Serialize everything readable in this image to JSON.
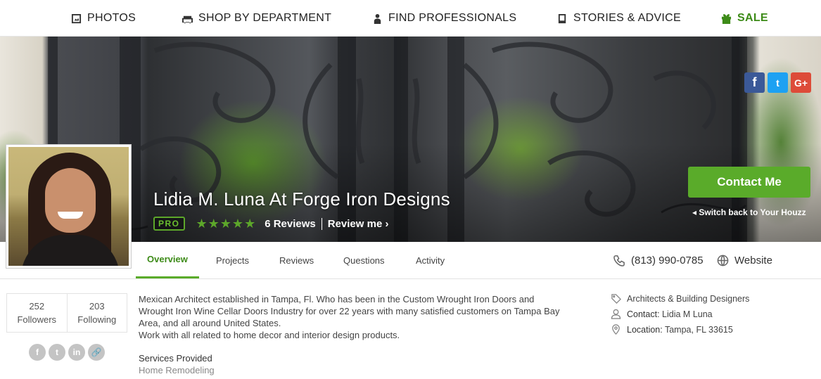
{
  "nav": {
    "items": [
      {
        "label": "PHOTOS",
        "icon": "photo-icon"
      },
      {
        "label": "SHOP BY DEPARTMENT",
        "icon": "couch-icon"
      },
      {
        "label": "FIND PROFESSIONALS",
        "icon": "person-icon"
      },
      {
        "label": "STORIES & ADVICE",
        "icon": "book-icon"
      },
      {
        "label": "SALE",
        "icon": "gift-icon",
        "color": "#3d8b18"
      }
    ]
  },
  "share_top": {
    "facebook": "f",
    "twitter": "t",
    "google": "G+"
  },
  "profile": {
    "name": "Lidia M. Luna At Forge Iron Designs",
    "badge": "PRO",
    "rating": 5,
    "stars": "★★★★★",
    "reviews": "6 Reviews",
    "review_me": "Review me ›",
    "contact_button": "Contact Me",
    "switch_back": "◂ Switch back to Your Houzz"
  },
  "tabs": [
    {
      "label": "Overview",
      "active": true
    },
    {
      "label": "Projects"
    },
    {
      "label": "Reviews"
    },
    {
      "label": "Questions"
    },
    {
      "label": "Activity"
    }
  ],
  "contact": {
    "phone": "(813) 990-0785",
    "website": "Website"
  },
  "stats": {
    "followers_count": "252",
    "followers_label": "Followers",
    "following_count": "203",
    "following_label": "Following"
  },
  "share_bottom": [
    "f",
    "t",
    "in",
    "🔗"
  ],
  "about": {
    "line1": "Mexican Architect established in Tampa, Fl. Who has been in the Custom Wrought Iron Doors and",
    "line2": "Wrought Iron Wine Cellar Doors Industry for over 22 years with many satisfied customers on Tampa Bay",
    "line3": "Area, and all around United States.",
    "line4": "Work with all related to home decor and interior design products.",
    "services_title": "Services Provided",
    "services_value": "Home Remodeling"
  },
  "details": {
    "category": "Architects & Building Designers",
    "contact_label": "Contact:",
    "contact_value": "Lidia M Luna",
    "location_label": "Location:",
    "location_value": "Tampa, FL 33615"
  },
  "colors": {
    "accent": "#5aab2a",
    "sale": "#3d8b18",
    "facebook": "#3b5998",
    "twitter": "#1da1f2",
    "google": "#dd4b39"
  }
}
